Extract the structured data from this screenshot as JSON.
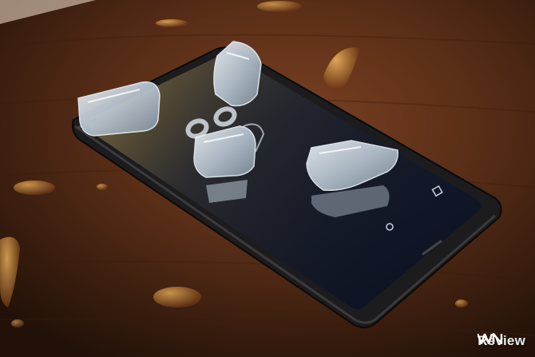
{
  "photo": {
    "subject": "smartphone",
    "watermark": {
      "text": "Review",
      "mark": "VN"
    }
  },
  "colors": {
    "wood": "#5a2e17",
    "wood_dark": "#2a160c",
    "phone_body": "#1c1c1e",
    "screen": "#0f1624",
    "ice": "#c9d6e3"
  }
}
